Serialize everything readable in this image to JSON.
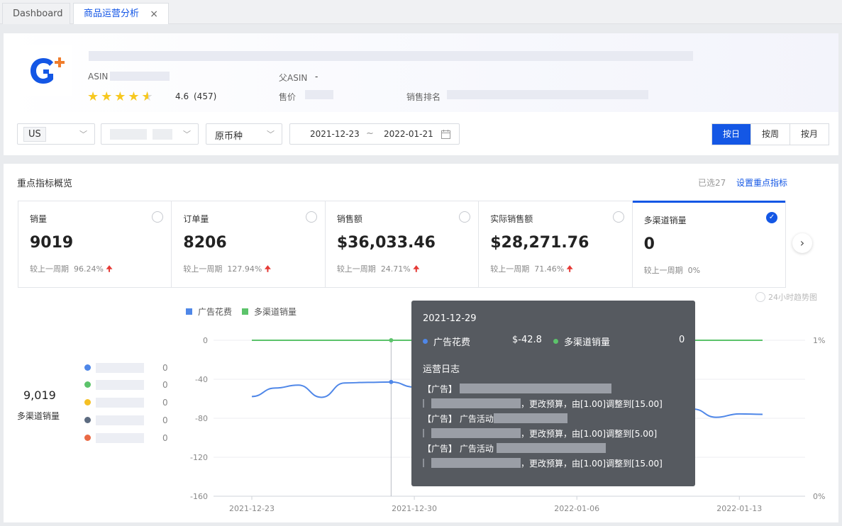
{
  "tabs": [
    {
      "label": "Dashboard"
    },
    {
      "label": "商品运营分析",
      "close": "×"
    }
  ],
  "product": {
    "asin_label": "ASIN",
    "parent_asin_label": "父ASIN",
    "parent_asin_value": "-",
    "price_label": "售价",
    "rank_label": "销售排名",
    "rating": "4.6",
    "reviews": "(457)"
  },
  "filters": {
    "country": "US",
    "currency": "原币种",
    "date_start": "2021-12-23",
    "date_sep": "~",
    "date_end": "2022-01-21",
    "granularity": [
      "按日",
      "按周",
      "按月"
    ],
    "active_granularity": 0
  },
  "overview": {
    "title": "重点指标概览",
    "selected_count": "已选27",
    "set_link": "设置重点指标"
  },
  "metrics": [
    {
      "name": "销量",
      "value": "9019",
      "cmp_label": "较上一周期",
      "cmp_value": "96.24%",
      "arrow": "🠉",
      "selected": false
    },
    {
      "name": "订单量",
      "value": "8206",
      "cmp_label": "较上一周期",
      "cmp_value": "127.94%",
      "arrow": "🠉",
      "selected": false
    },
    {
      "name": "销售额",
      "value": "$36,033.46",
      "cmp_label": "较上一周期",
      "cmp_value": "24.71%",
      "arrow": "🠉",
      "selected": false
    },
    {
      "name": "实际销售额",
      "value": "$28,271.76",
      "cmp_label": "较上一周期",
      "cmp_value": "71.46%",
      "arrow": "🠉",
      "selected": false
    },
    {
      "name": "多渠道销量",
      "value": "0",
      "cmp_label": "较上一周期",
      "cmp_value": "0%",
      "arrow": "",
      "selected": true
    }
  ],
  "hour_option": "24小时趋势图",
  "summary": {
    "total": "9,019",
    "total_label": "多渠道销量",
    "legend": [
      {
        "color": "#4f87e8",
        "value": "0"
      },
      {
        "color": "#5cc36b",
        "value": "0"
      },
      {
        "color": "#f5c024",
        "value": "0"
      },
      {
        "color": "#5c6b80",
        "value": "0"
      },
      {
        "color": "#ea6a45",
        "value": "0"
      }
    ]
  },
  "chart_data": {
    "type": "line",
    "legend": [
      {
        "name": "广告花费",
        "color": "#4f87e8"
      },
      {
        "name": "多渠道销量",
        "color": "#5cc36b"
      }
    ],
    "x_ticks": [
      "2021-12-23",
      "2021-12-30",
      "2022-01-06",
      "2022-01-13"
    ],
    "y_left_ticks": [
      "0",
      "-40",
      "-80",
      "-120",
      "-160"
    ],
    "y_right_ticks": [
      "1%",
      "0%"
    ],
    "ylim_left": [
      -160,
      0
    ],
    "x": [
      "2021-12-23",
      "2021-12-24",
      "2021-12-25",
      "2021-12-26",
      "2021-12-27",
      "2021-12-28",
      "2021-12-29",
      "2021-12-30",
      "2021-12-31",
      "2022-01-01",
      "2022-01-02",
      "2022-01-03",
      "2022-01-04",
      "2022-01-05",
      "2022-01-06",
      "2022-01-07",
      "2022-01-08",
      "2022-01-09",
      "2022-01-10",
      "2022-01-11",
      "2022-01-12",
      "2022-01-13",
      "2022-01-14"
    ],
    "series": [
      {
        "name": "广告花费",
        "values": [
          -57.7,
          -49,
          -46,
          -58.5,
          -43.8,
          -43.2,
          -42.8,
          -48,
          -52,
          -55,
          -58,
          -60,
          -62,
          -64,
          -66,
          -68,
          -69,
          -70,
          -71,
          -70.5,
          -79,
          -75.5,
          -76
        ]
      },
      {
        "name": "多渠道销量",
        "values": [
          0,
          0,
          0,
          0,
          0,
          0,
          0,
          0,
          0,
          0,
          0,
          0,
          0,
          0,
          0,
          0,
          0,
          0,
          0,
          0,
          0,
          0,
          0
        ]
      }
    ]
  },
  "tooltip": {
    "date": "2021-12-29",
    "s1_name": "广告花费",
    "s1_value": "$-42.8",
    "s2_name": "多渠道销量",
    "s2_value": "0",
    "log_title": "运营日志",
    "entries": [
      {
        "tag": "【广告】",
        "sub": "",
        "detail": "，更改预算，由[1.00]调整到[15.00]"
      },
      {
        "tag": "【广告】",
        "sub": "广告活动",
        "detail": "，更改预算，由[1.00]调整到[5.00]"
      },
      {
        "tag": "【广告】",
        "sub": "广告活动",
        "detail": "，更改预算，由[1.00]调整到[15.00]"
      }
    ]
  }
}
